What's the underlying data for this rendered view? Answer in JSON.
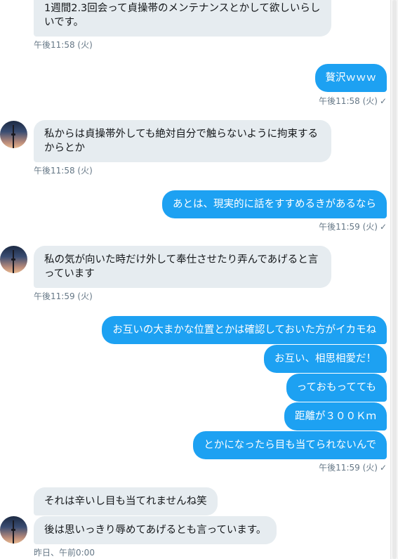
{
  "messages": [
    {
      "text": "1週間2.3回会って貞操帯のメンテナンスとかして欲しいらしいです。"
    },
    {
      "text": "贅沢ｗｗｗ"
    },
    {
      "text": "私からは貞操帯外しても絶対自分で触らないように拘束するからとか"
    },
    {
      "text": "あとは、現実的に話をすすめるきがあるなら"
    },
    {
      "text": "私の気が向いた時だけ外して奉仕させたり弄んであげると言っています"
    },
    {
      "text": "お互いの大まかな位置とかは確認しておいた方がイカモね"
    },
    {
      "text": "お互い、相思相愛だ！"
    },
    {
      "text": "っておもってても"
    },
    {
      "text": "距離が３００Ｋｍ"
    },
    {
      "text": "とかになったら目も当てられないんで"
    },
    {
      "text": "それは辛いし目も当てれませんね笑"
    },
    {
      "text": "後は思いっきり辱めてあげるとも言っています。"
    }
  ],
  "timestamps": [
    "午後11:58 (火)",
    "午後11:58 (火)",
    "午後11:58 (火)",
    "午後11:59 (火)",
    "午後11:59 (火)",
    "午後11:59 (火)",
    "昨日、午前0:00"
  ],
  "icons": {
    "read_check": "✓"
  },
  "colors": {
    "outgoing": "#1da1f2",
    "incoming": "#e6ecf0",
    "meta": "#657786"
  }
}
